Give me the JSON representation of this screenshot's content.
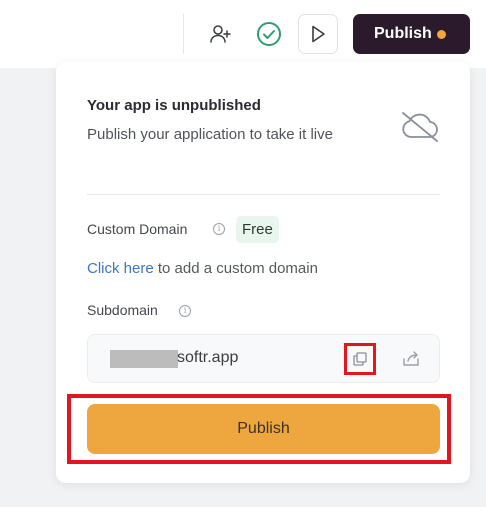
{
  "topbar": {
    "publish_label": "Publish",
    "status_dot_color": "#f3a63b",
    "icons": [
      "add-user-icon",
      "check-circle-icon",
      "play-icon"
    ]
  },
  "panel": {
    "title": "Your app is unpublished",
    "subtitle": "Publish your application to take it live",
    "status_icon": "cloud-off-icon",
    "custom_domain": {
      "label": "Custom Domain",
      "badge": "Free",
      "link_text": "Click here",
      "link_suffix": " to add a custom domain"
    },
    "subdomain": {
      "label": "Subdomain",
      "value_suffix": "softr.app",
      "copy_icon": "copy-icon",
      "open_icon": "external-link-icon"
    },
    "publish_button_label": "Publish"
  },
  "colors": {
    "dark_button": "#2a1a2b",
    "accent_orange": "#eea73f",
    "success_green": "#2e9e6b",
    "link_blue": "#3b78c2",
    "annotation_red": "#e3151f"
  }
}
